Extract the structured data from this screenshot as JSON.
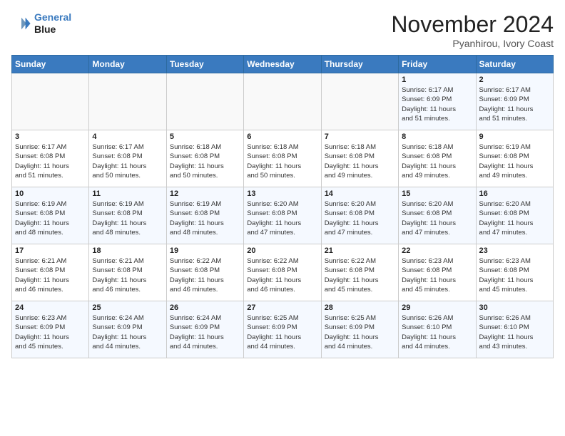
{
  "header": {
    "logo_line1": "General",
    "logo_line2": "Blue",
    "month_title": "November 2024",
    "location": "Pyanhirou, Ivory Coast"
  },
  "weekdays": [
    "Sunday",
    "Monday",
    "Tuesday",
    "Wednesday",
    "Thursday",
    "Friday",
    "Saturday"
  ],
  "weeks": [
    [
      {
        "day": "",
        "info": ""
      },
      {
        "day": "",
        "info": ""
      },
      {
        "day": "",
        "info": ""
      },
      {
        "day": "",
        "info": ""
      },
      {
        "day": "",
        "info": ""
      },
      {
        "day": "1",
        "info": "Sunrise: 6:17 AM\nSunset: 6:09 PM\nDaylight: 11 hours\nand 51 minutes."
      },
      {
        "day": "2",
        "info": "Sunrise: 6:17 AM\nSunset: 6:09 PM\nDaylight: 11 hours\nand 51 minutes."
      }
    ],
    [
      {
        "day": "3",
        "info": "Sunrise: 6:17 AM\nSunset: 6:08 PM\nDaylight: 11 hours\nand 51 minutes."
      },
      {
        "day": "4",
        "info": "Sunrise: 6:17 AM\nSunset: 6:08 PM\nDaylight: 11 hours\nand 50 minutes."
      },
      {
        "day": "5",
        "info": "Sunrise: 6:18 AM\nSunset: 6:08 PM\nDaylight: 11 hours\nand 50 minutes."
      },
      {
        "day": "6",
        "info": "Sunrise: 6:18 AM\nSunset: 6:08 PM\nDaylight: 11 hours\nand 50 minutes."
      },
      {
        "day": "7",
        "info": "Sunrise: 6:18 AM\nSunset: 6:08 PM\nDaylight: 11 hours\nand 49 minutes."
      },
      {
        "day": "8",
        "info": "Sunrise: 6:18 AM\nSunset: 6:08 PM\nDaylight: 11 hours\nand 49 minutes."
      },
      {
        "day": "9",
        "info": "Sunrise: 6:19 AM\nSunset: 6:08 PM\nDaylight: 11 hours\nand 49 minutes."
      }
    ],
    [
      {
        "day": "10",
        "info": "Sunrise: 6:19 AM\nSunset: 6:08 PM\nDaylight: 11 hours\nand 48 minutes."
      },
      {
        "day": "11",
        "info": "Sunrise: 6:19 AM\nSunset: 6:08 PM\nDaylight: 11 hours\nand 48 minutes."
      },
      {
        "day": "12",
        "info": "Sunrise: 6:19 AM\nSunset: 6:08 PM\nDaylight: 11 hours\nand 48 minutes."
      },
      {
        "day": "13",
        "info": "Sunrise: 6:20 AM\nSunset: 6:08 PM\nDaylight: 11 hours\nand 47 minutes."
      },
      {
        "day": "14",
        "info": "Sunrise: 6:20 AM\nSunset: 6:08 PM\nDaylight: 11 hours\nand 47 minutes."
      },
      {
        "day": "15",
        "info": "Sunrise: 6:20 AM\nSunset: 6:08 PM\nDaylight: 11 hours\nand 47 minutes."
      },
      {
        "day": "16",
        "info": "Sunrise: 6:20 AM\nSunset: 6:08 PM\nDaylight: 11 hours\nand 47 minutes."
      }
    ],
    [
      {
        "day": "17",
        "info": "Sunrise: 6:21 AM\nSunset: 6:08 PM\nDaylight: 11 hours\nand 46 minutes."
      },
      {
        "day": "18",
        "info": "Sunrise: 6:21 AM\nSunset: 6:08 PM\nDaylight: 11 hours\nand 46 minutes."
      },
      {
        "day": "19",
        "info": "Sunrise: 6:22 AM\nSunset: 6:08 PM\nDaylight: 11 hours\nand 46 minutes."
      },
      {
        "day": "20",
        "info": "Sunrise: 6:22 AM\nSunset: 6:08 PM\nDaylight: 11 hours\nand 46 minutes."
      },
      {
        "day": "21",
        "info": "Sunrise: 6:22 AM\nSunset: 6:08 PM\nDaylight: 11 hours\nand 45 minutes."
      },
      {
        "day": "22",
        "info": "Sunrise: 6:23 AM\nSunset: 6:08 PM\nDaylight: 11 hours\nand 45 minutes."
      },
      {
        "day": "23",
        "info": "Sunrise: 6:23 AM\nSunset: 6:08 PM\nDaylight: 11 hours\nand 45 minutes."
      }
    ],
    [
      {
        "day": "24",
        "info": "Sunrise: 6:23 AM\nSunset: 6:09 PM\nDaylight: 11 hours\nand 45 minutes."
      },
      {
        "day": "25",
        "info": "Sunrise: 6:24 AM\nSunset: 6:09 PM\nDaylight: 11 hours\nand 44 minutes."
      },
      {
        "day": "26",
        "info": "Sunrise: 6:24 AM\nSunset: 6:09 PM\nDaylight: 11 hours\nand 44 minutes."
      },
      {
        "day": "27",
        "info": "Sunrise: 6:25 AM\nSunset: 6:09 PM\nDaylight: 11 hours\nand 44 minutes."
      },
      {
        "day": "28",
        "info": "Sunrise: 6:25 AM\nSunset: 6:09 PM\nDaylight: 11 hours\nand 44 minutes."
      },
      {
        "day": "29",
        "info": "Sunrise: 6:26 AM\nSunset: 6:10 PM\nDaylight: 11 hours\nand 44 minutes."
      },
      {
        "day": "30",
        "info": "Sunrise: 6:26 AM\nSunset: 6:10 PM\nDaylight: 11 hours\nand 43 minutes."
      }
    ]
  ]
}
